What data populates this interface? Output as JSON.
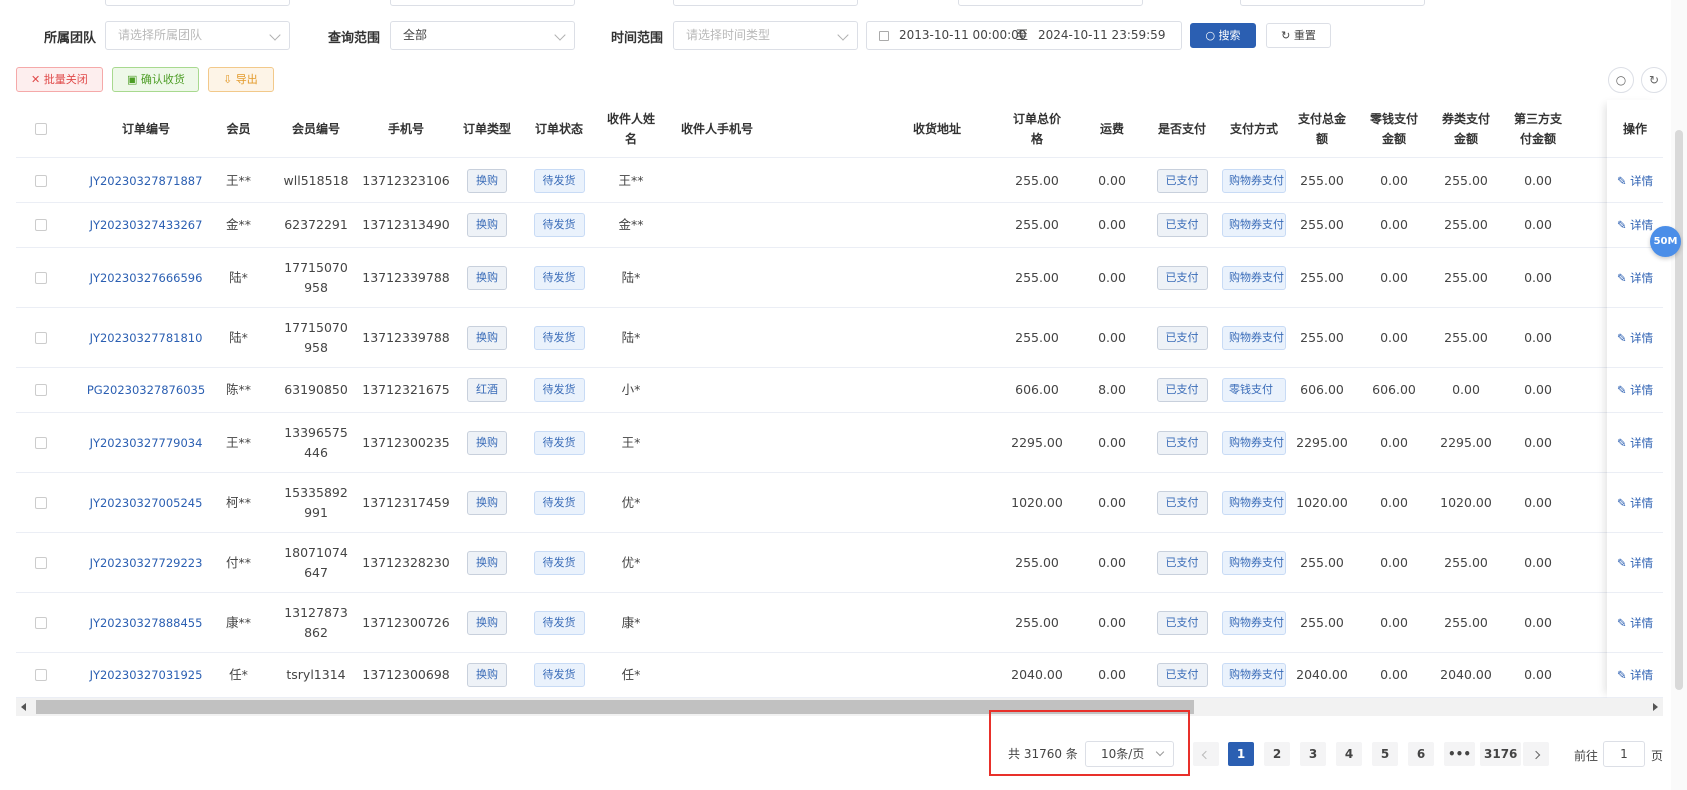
{
  "filters": {
    "team_label": "所属团队",
    "team_placeholder": "请选择所属团队",
    "scope_label": "查询范围",
    "scope_value": "全部",
    "time_label": "时间范围",
    "time_placeholder": "请选择时间类型",
    "date_start": "2013-10-11 00:00:00",
    "date_sep": "至",
    "date_end": "2024-10-11 23:59:59",
    "search_label": "搜索",
    "reset_label": "重置"
  },
  "actions": {
    "batch_close": "批量关闭",
    "confirm_receipt": "确认收货",
    "export": "导出"
  },
  "table": {
    "headers": {
      "order_no": "订单编号",
      "member": "会员",
      "member_no": "会员编号",
      "phone": "手机号",
      "order_type": "订单类型",
      "order_status": "订单状态",
      "recv_name_1": "收件人姓",
      "recv_name_2": "名",
      "recv_phone": "收件人手机号",
      "address": "收货地址",
      "total_1": "订单总价",
      "total_2": "格",
      "freight": "运费",
      "paid": "是否支付",
      "pay_method": "支付方式",
      "pay_total_1": "支付总金",
      "pay_total_2": "额",
      "change_pay_1": "零钱支付",
      "change_pay_2": "金额",
      "voucher_pay_1": "券类支付",
      "voucher_pay_2": "金额",
      "third_pay_1": "第三方支",
      "third_pay_2": "付金额",
      "operation": "操作"
    },
    "rows": [
      {
        "order_no": "JY20230327871887",
        "member": "王**",
        "member_no_1": "wll518518",
        "member_no_2": "",
        "phone": "13712323106",
        "type": "换购",
        "status": "待发货",
        "recv": "王**",
        "total": "255.00",
        "freight": "0.00",
        "paid": "已支付",
        "method": "购物券支付",
        "pay_total": "255.00",
        "change": "0.00",
        "voucher": "255.00",
        "third": "0.00",
        "op": "详情"
      },
      {
        "order_no": "JY20230327433267",
        "member": "金**",
        "member_no_1": "62372291",
        "member_no_2": "",
        "phone": "13712313490",
        "type": "换购",
        "status": "待发货",
        "recv": "金**",
        "total": "255.00",
        "freight": "0.00",
        "paid": "已支付",
        "method": "购物券支付",
        "pay_total": "255.00",
        "change": "0.00",
        "voucher": "255.00",
        "third": "0.00",
        "op": "详情"
      },
      {
        "order_no": "JY20230327666596",
        "member": "陆*",
        "member_no_1": "17715070",
        "member_no_2": "958",
        "phone": "13712339788",
        "type": "换购",
        "status": "待发货",
        "recv": "陆*",
        "total": "255.00",
        "freight": "0.00",
        "paid": "已支付",
        "method": "购物券支付",
        "pay_total": "255.00",
        "change": "0.00",
        "voucher": "255.00",
        "third": "0.00",
        "op": "详情"
      },
      {
        "order_no": "JY20230327781810",
        "member": "陆*",
        "member_no_1": "17715070",
        "member_no_2": "958",
        "phone": "13712339788",
        "type": "换购",
        "status": "待发货",
        "recv": "陆*",
        "total": "255.00",
        "freight": "0.00",
        "paid": "已支付",
        "method": "购物券支付",
        "pay_total": "255.00",
        "change": "0.00",
        "voucher": "255.00",
        "third": "0.00",
        "op": "详情"
      },
      {
        "order_no": "PG20230327876035",
        "member": "陈**",
        "member_no_1": "63190850",
        "member_no_2": "",
        "phone": "13712321675",
        "type": "红酒",
        "status": "待发货",
        "recv": "小*",
        "total": "606.00",
        "freight": "8.00",
        "paid": "已支付",
        "method": "零钱支付",
        "pay_total": "606.00",
        "change": "606.00",
        "voucher": "0.00",
        "third": "0.00",
        "op": "详情"
      },
      {
        "order_no": "JY20230327779034",
        "member": "王**",
        "member_no_1": "13396575",
        "member_no_2": "446",
        "phone": "13712300235",
        "type": "换购",
        "status": "待发货",
        "recv": "王*",
        "total": "2295.00",
        "freight": "0.00",
        "paid": "已支付",
        "method": "购物券支付",
        "pay_total": "2295.00",
        "change": "0.00",
        "voucher": "2295.00",
        "third": "0.00",
        "op": "详情"
      },
      {
        "order_no": "JY20230327005245",
        "member": "柯**",
        "member_no_1": "15335892",
        "member_no_2": "991",
        "phone": "13712317459",
        "type": "换购",
        "status": "待发货",
        "recv": "优*",
        "total": "1020.00",
        "freight": "0.00",
        "paid": "已支付",
        "method": "购物券支付",
        "pay_total": "1020.00",
        "change": "0.00",
        "voucher": "1020.00",
        "third": "0.00",
        "op": "详情"
      },
      {
        "order_no": "JY20230327729223",
        "member": "付**",
        "member_no_1": "18071074",
        "member_no_2": "647",
        "phone": "13712328230",
        "type": "换购",
        "status": "待发货",
        "recv": "优*",
        "total": "255.00",
        "freight": "0.00",
        "paid": "已支付",
        "method": "购物券支付",
        "pay_total": "255.00",
        "change": "0.00",
        "voucher": "255.00",
        "third": "0.00",
        "op": "详情"
      },
      {
        "order_no": "JY20230327888455",
        "member": "康**",
        "member_no_1": "13127873",
        "member_no_2": "862",
        "phone": "13712300726",
        "type": "换购",
        "status": "待发货",
        "recv": "康*",
        "total": "255.00",
        "freight": "0.00",
        "paid": "已支付",
        "method": "购物券支付",
        "pay_total": "255.00",
        "change": "0.00",
        "voucher": "255.00",
        "third": "0.00",
        "op": "详情"
      },
      {
        "order_no": "JY20230327031925",
        "member": "任*",
        "member_no_1": "tsryl1314",
        "member_no_2": "",
        "phone": "13712300698",
        "type": "换购",
        "status": "待发货",
        "recv": "任*",
        "total": "2040.00",
        "freight": "0.00",
        "paid": "已支付",
        "method": "购物券支付",
        "pay_total": "2040.00",
        "change": "0.00",
        "voucher": "2040.00",
        "third": "0.00",
        "op": "详情"
      }
    ]
  },
  "badge": "50M",
  "pagination": {
    "total": "共 31760 条",
    "page_size": "10条/页",
    "pages": [
      "1",
      "2",
      "3",
      "4",
      "5",
      "6",
      "•••",
      "3176"
    ],
    "current": "1",
    "goto_prefix": "前往",
    "goto_value": "1",
    "goto_suffix": "页"
  },
  "colors": {
    "primary": "#2b5fb2",
    "danger": "#e04949",
    "success": "#4c9d25",
    "warning": "#e39a2a",
    "highlight_box": "#e8302a"
  }
}
